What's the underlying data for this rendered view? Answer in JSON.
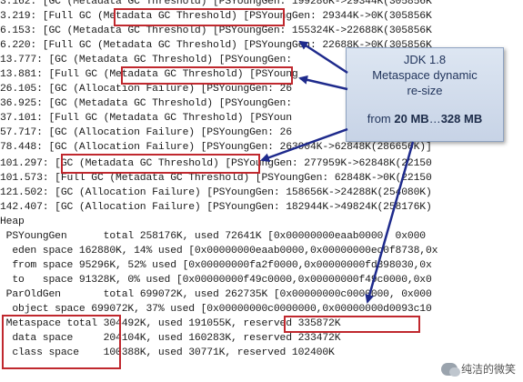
{
  "gc_log": {
    "lines": [
      "3.162: [GC (Metadata GC Threshold) [PSYoungGen: 199286K->29344K(305856K",
      "3.219: [Full GC (Metadata GC Threshold) [PSYoungGen: 29344K->0K(305856K",
      "6.153: [GC (Metadata GC Threshold) [PSYoungGen: 155324K->22688K(305856K",
      "6.220: [Full GC (Metadata GC Threshold) [PSYoungGen: 22688K->0K(305856K",
      "13.777: [GC (Metadata GC Threshold) [PSYoungGen: ",
      "13.881: [Full GC (Metadata GC Threshold) [PSYoung",
      "26.105: [GC (Allocation Failure) [PSYoungGen: 26",
      "36.925: [GC (Metadata GC Threshold) [PSYoungGen:",
      "37.101: [Full GC (Metadata GC Threshold) [PSYoun",
      "57.717: [GC (Allocation Failure) [PSYoungGen: 26",
      "78.448: [GC (Allocation Failure) [PSYoungGen: 263904K->62848K(286656K)]",
      "101.297: [GC (Metadata GC Threshold) [PSYoungGen: 277959K->62848K(22150",
      "101.573: [Full GC (Metadata GC Threshold) [PSYoungGen: 62848K->0K(22150",
      "121.502: [GC (Allocation Failure) [PSYoungGen: 158656K->24288K(254080K)",
      "142.407: [GC (Allocation Failure) [PSYoungGen: 182944K->49824K(258176K)",
      "Heap",
      " PSYoungGen      total 258176K, used 72641K [0x00000000eaab0000, 0x000",
      "  eden space 162880K, 14% used [0x00000000eaab0000,0x00000000ec0f8738,0x",
      "  from space 95296K, 52% used [0x00000000fa2f0000,0x00000000fd398030,0x",
      "  to   space 91328K, 0% used [0x00000000f49c0000,0x00000000f49c0000,0x0",
      " ParOldGen       total 699072K, used 262735K [0x00000000c0000000, 0x000",
      "  object space 699072K, 37% used [0x00000000c0000000,0x00000000d0093c10",
      " Metaspace total 304492K, used 191055K, reserved 335872K",
      "  data space     204104K, used 160283K, reserved 233472K",
      "  class space    100388K, used 30771K, reserved 102400K"
    ]
  },
  "callout": {
    "line1": "JDK 1.8",
    "line2": "Metaspace dynamic",
    "line3": "re-size",
    "from_prefix": "from ",
    "from_value": "20 MB",
    "separator": "…",
    "to_value": "328 MB"
  },
  "watermark": {
    "text": "纯洁的微笑",
    "icon": "wechat-icon"
  },
  "colors": {
    "highlight": "#c0282e",
    "arrow": "#1e2a8c",
    "callout_bg": "#d2dced",
    "text": "#1a1a1a"
  }
}
